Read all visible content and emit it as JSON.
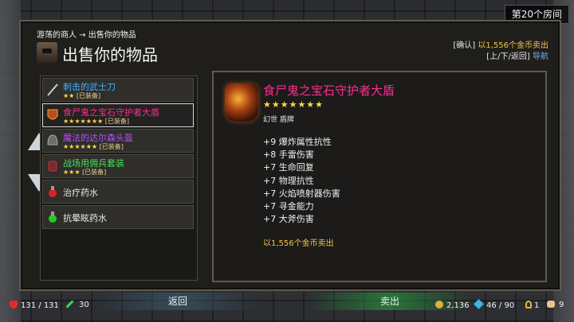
{
  "room_label": "第20个房间",
  "breadcrumb": "游荡的商人 → 出售你的物品",
  "title": "出售你的物品",
  "hint": {
    "confirm_prefix": "[确认]",
    "confirm_text": "以1,556个金币卖出",
    "nav_prefix": "[上/下/返回]",
    "nav_text": "导航"
  },
  "items": [
    {
      "name": "刺击的武士刀",
      "stars": "★★",
      "tag": "[已装备]",
      "color": "#3fb2ff",
      "icon": "sword-icon"
    },
    {
      "name": "食尸鬼之宝石守护者大盾",
      "stars": "★★★★★★★",
      "tag": "[已装备]",
      "color": "#ff2c8f",
      "icon": "shield-icon"
    },
    {
      "name": "魔法的达尔森头盔",
      "stars": "★★★★★★",
      "tag": "[已装备]",
      "color": "#b74dff",
      "icon": "helmet-icon"
    },
    {
      "name": "战场用佣兵套装",
      "stars": "★★★",
      "tag": "[已装备]",
      "color": "#46e05a",
      "icon": "armor-icon"
    },
    {
      "name": "治疗药水",
      "stars": "",
      "tag": "",
      "color": "#f0f0f0",
      "icon": "red-potion-icon"
    },
    {
      "name": "抗晕眩药水",
      "stars": "",
      "tag": "",
      "color": "#f0f0f0",
      "icon": "green-potion-icon"
    }
  ],
  "detail": {
    "name": "食尸鬼之宝石守护者大盾",
    "stars": "★★★★★★★",
    "type": "幻世 盾牌",
    "stats": [
      "+9 爆炸属性抗性",
      "+8 手雷伤害",
      "+7 生命回复",
      "+7 物理抗性",
      "+7 火焰喷射器伤害",
      "+7 寻金能力",
      "+7 大斧伤害"
    ],
    "sell_text": "以1,556个金币卖出"
  },
  "buttons": {
    "back": "返回",
    "sell": "卖出"
  },
  "hud": {
    "hp": "131 / 131",
    "attack": "30",
    "gold": "2,136",
    "gems": "46 / 90",
    "keys": "1",
    "pets": "9"
  }
}
